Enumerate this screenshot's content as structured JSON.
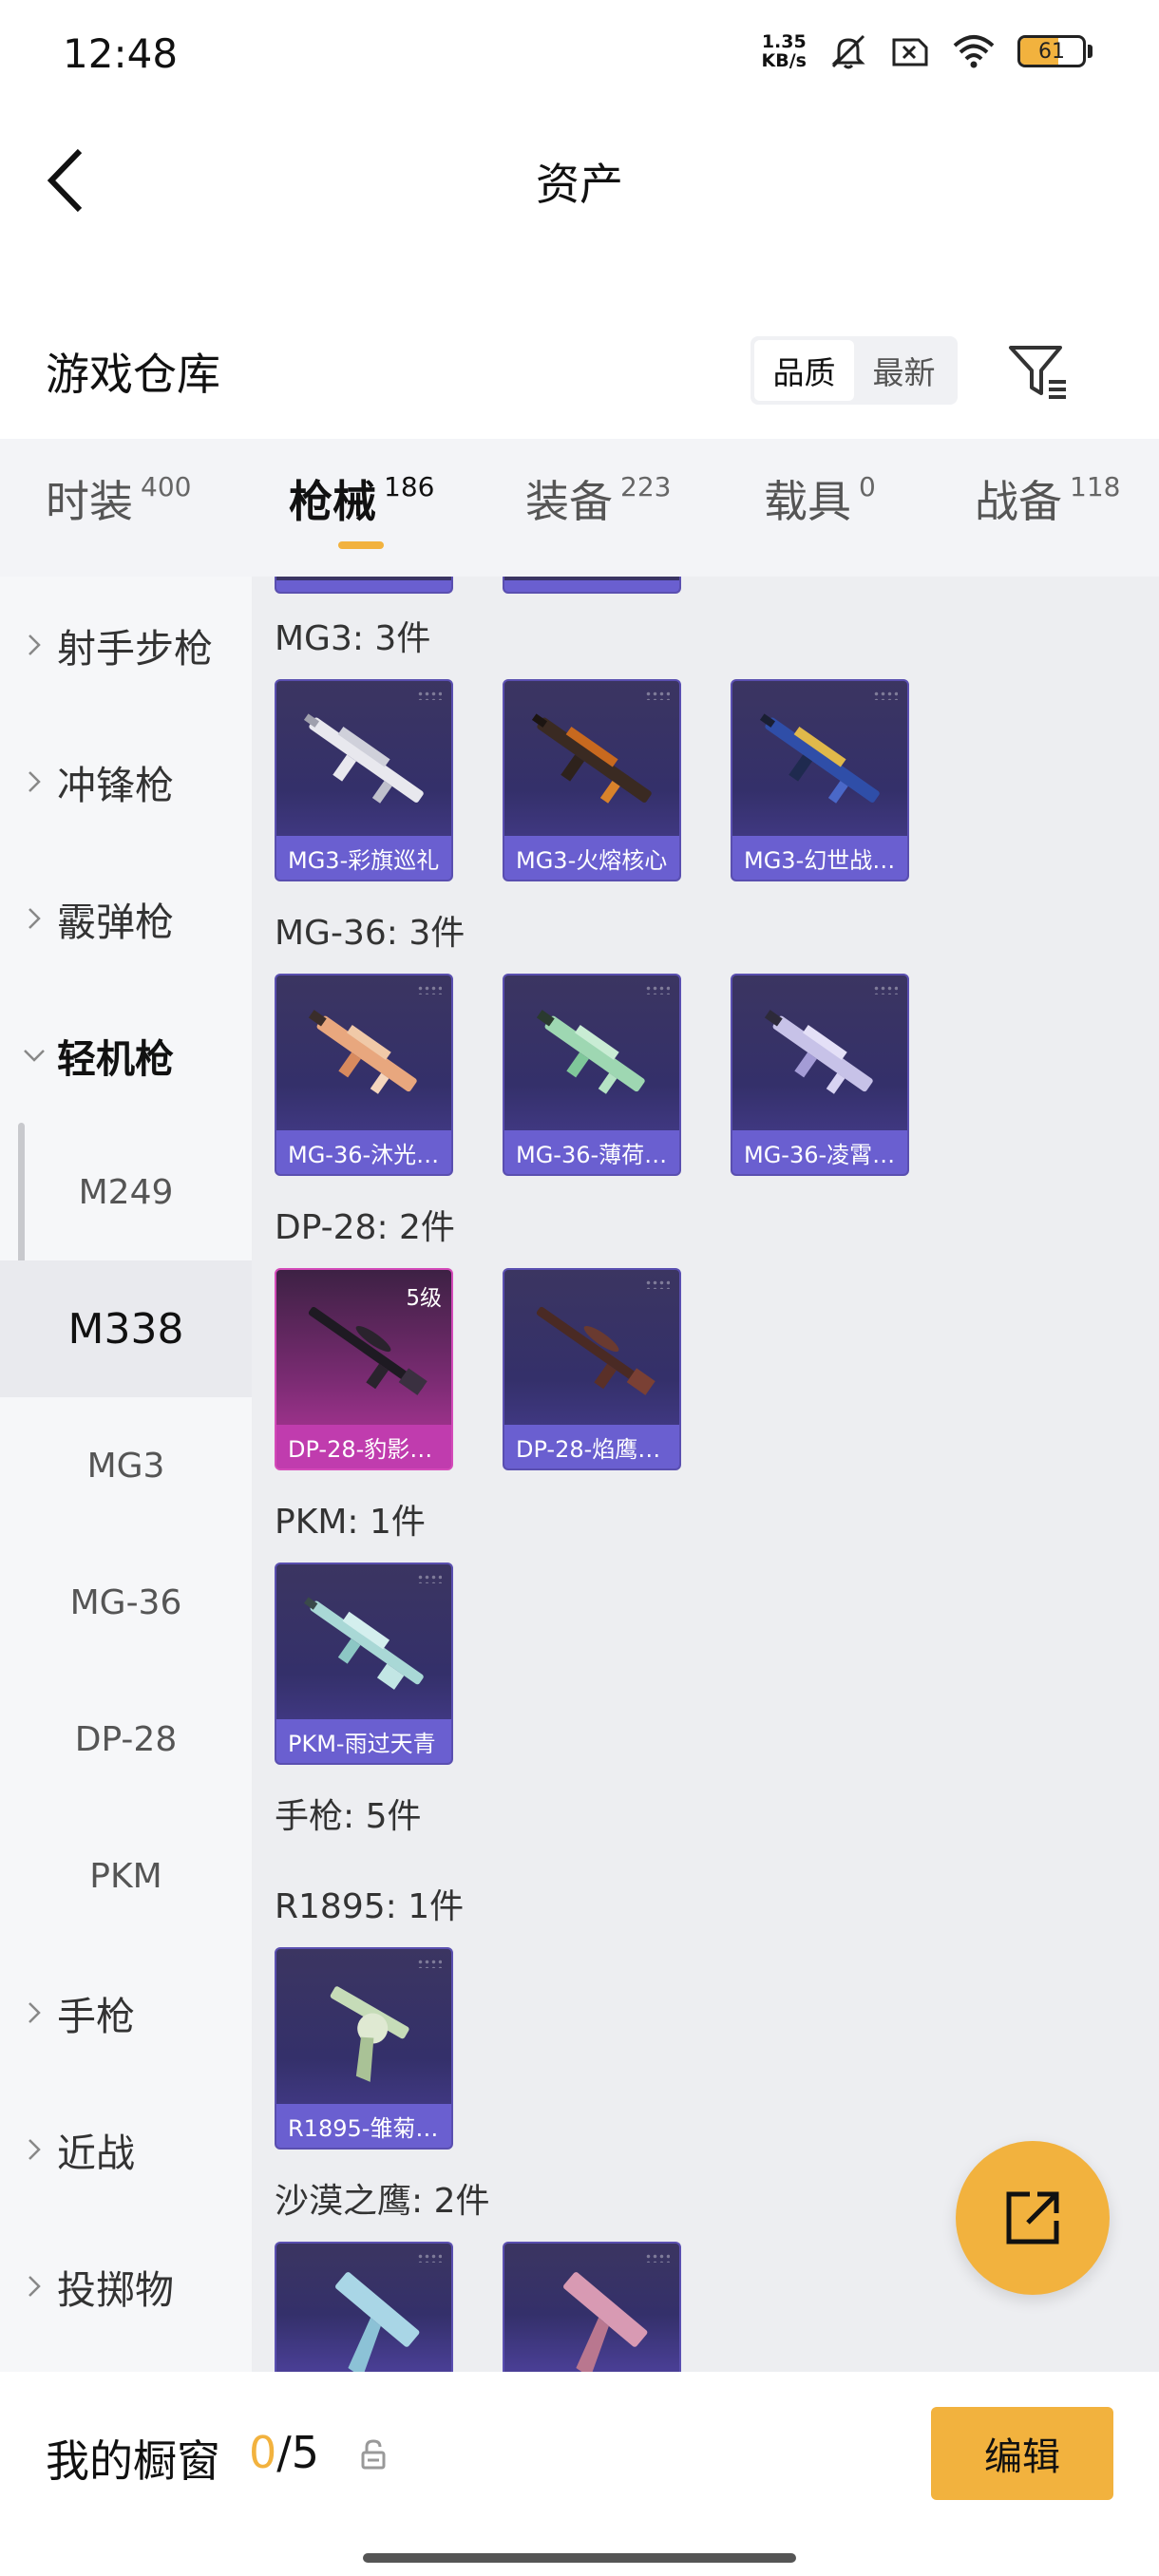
{
  "status_bar": {
    "time": "12:48",
    "net_speed_top": "1.35",
    "net_speed_bottom": "KB/s",
    "battery": "61",
    "battery_level": 0.61,
    "icons": [
      "mute-icon",
      "no-sim-icon",
      "wifi-icon",
      "battery-icon"
    ]
  },
  "header": {
    "title": "资产",
    "back_icon": "chevron-left-icon"
  },
  "warehouse": {
    "title": "游戏仓库",
    "sort_options": [
      "品质",
      "最新"
    ],
    "sort_selected": "品质",
    "filter_icon": "filter-icon"
  },
  "tabs": [
    {
      "label": "时装",
      "count": "400"
    },
    {
      "label": "枪械",
      "count": "186"
    },
    {
      "label": "装备",
      "count": "223"
    },
    {
      "label": "载具",
      "count": "0"
    },
    {
      "label": "战备",
      "count": "118"
    }
  ],
  "active_tab": "枪械",
  "accent_color": "#f2b23e",
  "sidebar": {
    "categories": [
      {
        "label": "射手步枪"
      },
      {
        "label": "冲锋枪"
      },
      {
        "label": "霰弹枪"
      },
      {
        "label": "轻机枪",
        "expanded": true
      },
      {
        "label": "手枪"
      },
      {
        "label": "近战"
      },
      {
        "label": "投掷物"
      }
    ],
    "subitems": [
      "M249",
      "M338",
      "MG3",
      "MG-36",
      "DP-28",
      "PKM"
    ],
    "selected_subitem": "M338"
  },
  "groups": [
    {
      "title": "MG3: 3件",
      "items": [
        {
          "label": "MG3-彩旗巡礼"
        },
        {
          "label": "MG3-火熔核心"
        },
        {
          "label": "MG3-幻世战…"
        }
      ]
    },
    {
      "title": "MG-36: 3件",
      "items": [
        {
          "label": "MG-36-沐光…"
        },
        {
          "label": "MG-36-薄荷…"
        },
        {
          "label": "MG-36-凌霄…"
        }
      ]
    },
    {
      "title": "DP-28: 2件",
      "items": [
        {
          "label": "DP-28-豹影…",
          "level": "5级",
          "rarity": "gold"
        },
        {
          "label": "DP-28-焰鹰…"
        }
      ]
    },
    {
      "title": "PKM: 1件",
      "items": [
        {
          "label": "PKM-雨过天青"
        }
      ]
    },
    {
      "title": "手枪: 5件",
      "items": []
    },
    {
      "title": "R1895: 1件",
      "items": [
        {
          "label": "R1895-雏菊…"
        }
      ]
    },
    {
      "title": "沙漠之鹰: 2件",
      "items": []
    }
  ],
  "fab_icon": "share-external-icon",
  "bottom": {
    "showcase_label": "我的橱窗",
    "used": "0",
    "total": "/5",
    "lock_icon": "lock-icon",
    "edit_label": "编辑"
  }
}
